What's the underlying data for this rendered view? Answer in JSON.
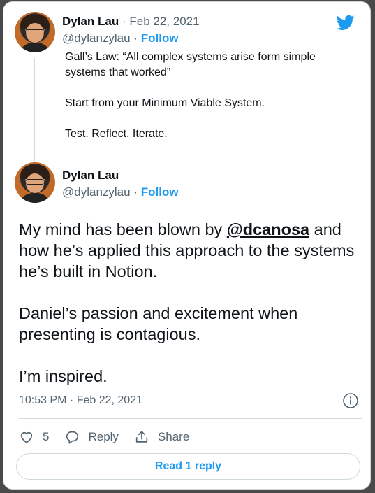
{
  "reply_tweet": {
    "author_name": "Dylan Lau",
    "date": "· Feb 22, 2021",
    "handle": "@dylanzylau",
    "separator": "·",
    "follow_label": "Follow",
    "paragraphs": [
      "Gall’s Law: “All complex systems arise form simple systems that worked”",
      "Start from your Minimum Viable System.",
      "Test. Reflect. Iterate."
    ]
  },
  "main_tweet": {
    "author_name": "Dylan Lau",
    "handle": "@dylanzylau",
    "separator": "·",
    "follow_label": "Follow",
    "text_line1_before": "My mind has been blown by ",
    "mention": "@dcanosa",
    "text_line1_after": " and how he’s applied this approach to the systems he’s built in Notion.",
    "paragraph2": "Daniel’s passion and excitement when presenting is contagious.",
    "paragraph3": "I’m inspired.",
    "timestamp": "10:53 PM · Feb 22, 2021"
  },
  "actions": {
    "like_count": "5",
    "reply_label": "Reply",
    "share_label": "Share"
  },
  "read_replies_label": "Read 1 reply",
  "colors": {
    "accent": "#1d9bf0",
    "text": "#0f1419",
    "secondary": "#536471"
  },
  "icons": [
    "twitter-logo-icon",
    "info-icon",
    "heart-icon",
    "reply-icon",
    "share-icon"
  ]
}
